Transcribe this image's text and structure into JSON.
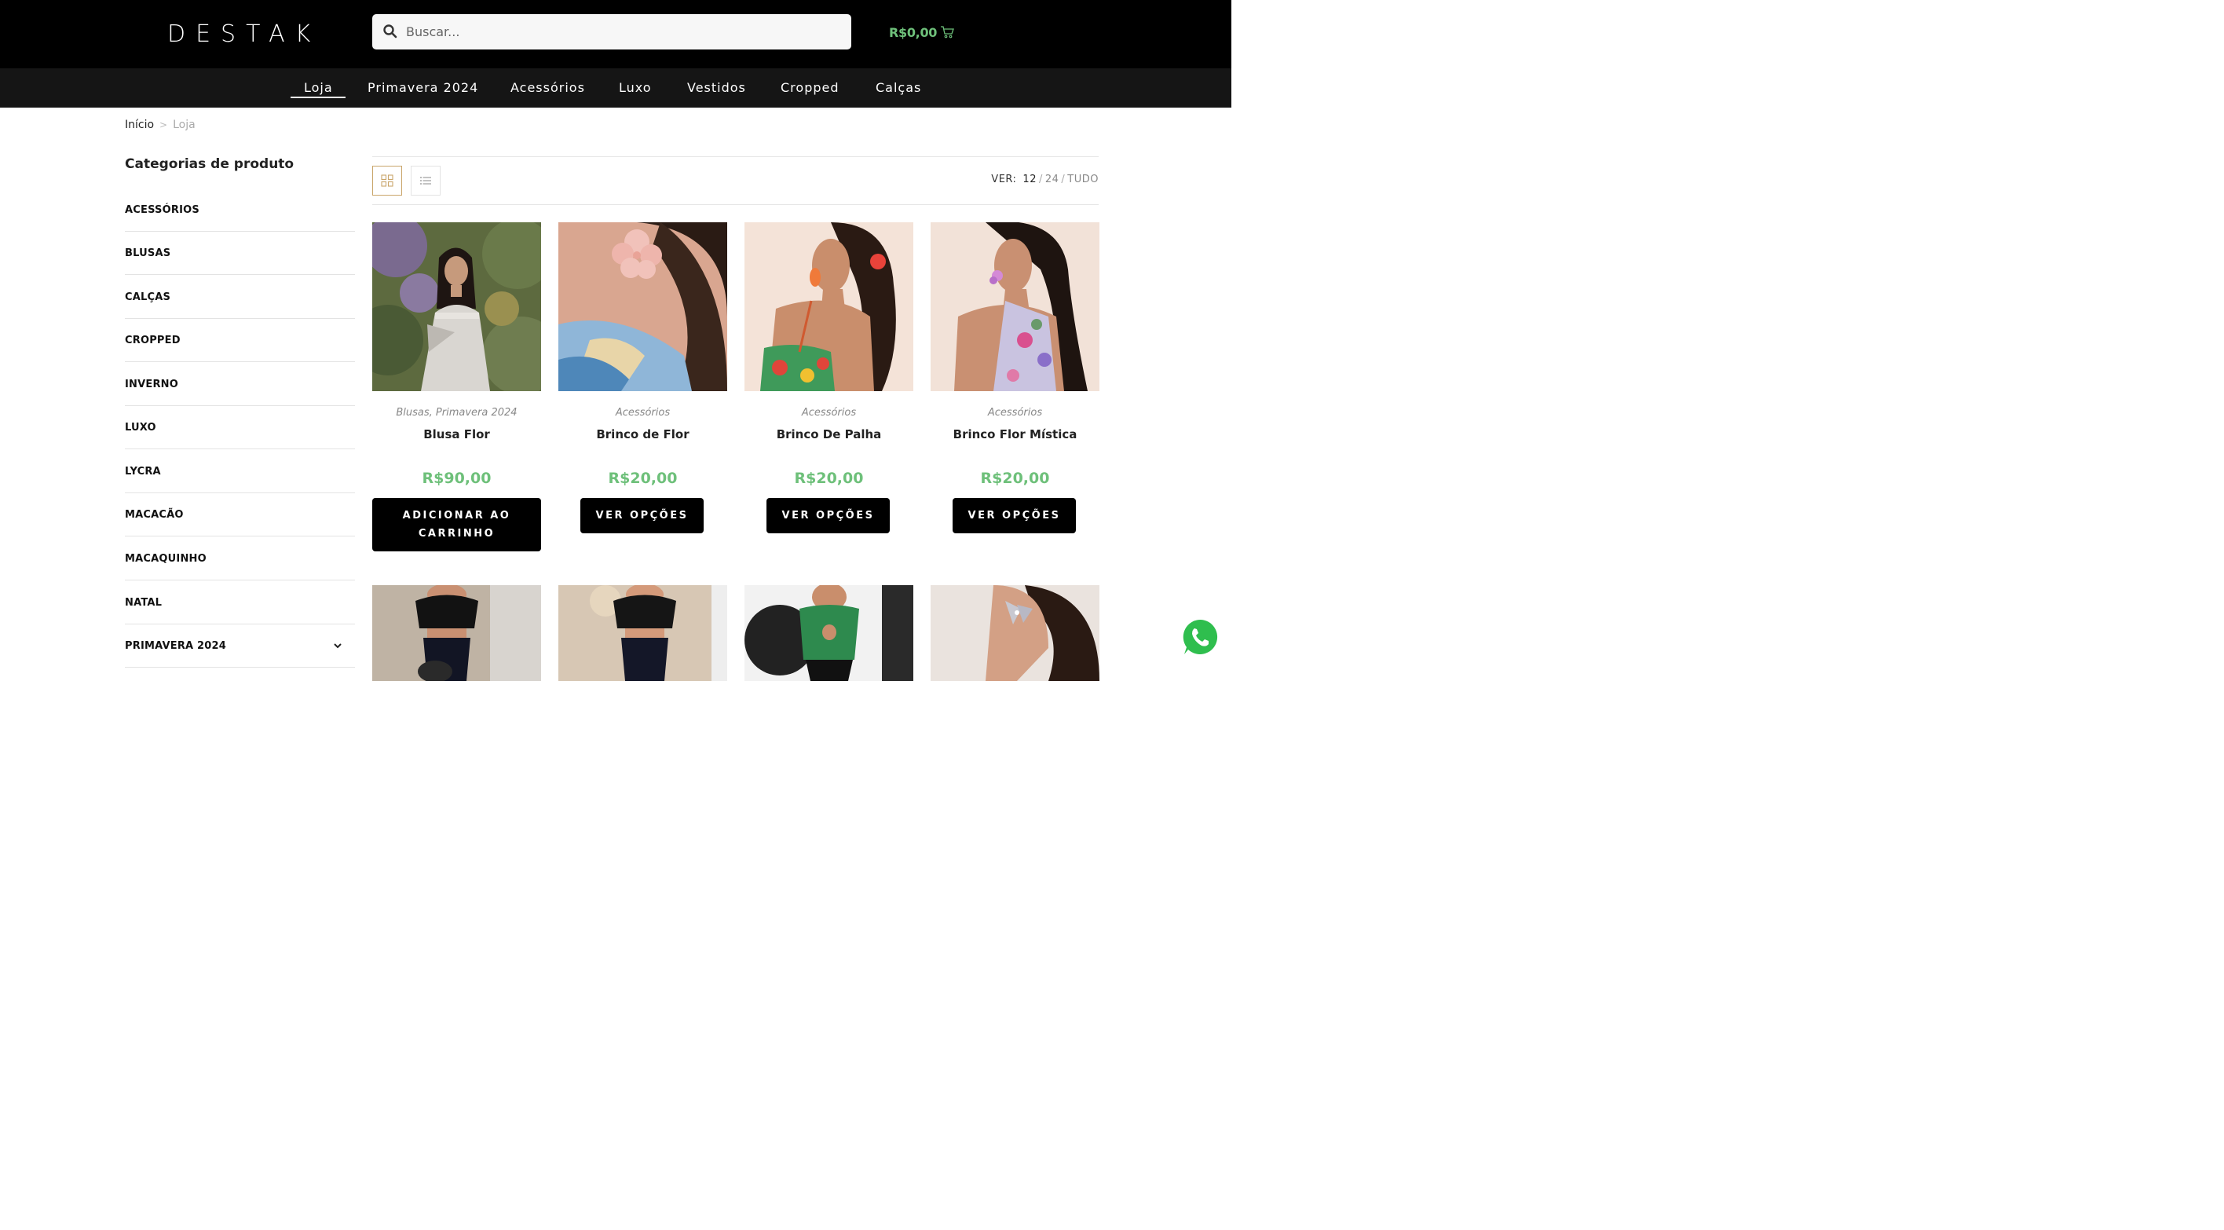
{
  "header": {
    "logo": "DESTAK",
    "search_placeholder": "Buscar...",
    "cart_total": "R$0,00"
  },
  "nav": {
    "items": [
      "Loja",
      "Primavera 2024",
      "Acessórios",
      "Luxo",
      "Vestidos",
      "Cropped",
      "Calças"
    ],
    "active": "Loja"
  },
  "breadcrumb": {
    "home": "Início",
    "separator": ">",
    "current": "Loja"
  },
  "sidebar": {
    "title": "Categorias de produto",
    "items": [
      "ACESSÓRIOS",
      "BLUSAS",
      "CALÇAS",
      "CROPPED",
      "INVERNO",
      "LUXO",
      "LYCRA",
      "MACACÃO",
      "MACAQUINHO",
      "NATAL",
      "PRIMAVERA 2024"
    ]
  },
  "toolbar": {
    "view_label": "VER:",
    "options": [
      "12",
      "24",
      "TUDO"
    ],
    "selected": "12"
  },
  "products": [
    {
      "categories": "Blusas, Primavera 2024",
      "name": "Blusa Flor",
      "price": "R$90,00",
      "button": "ADICIONAR AO CARRINHO",
      "image": "woman-white-dress-garden"
    },
    {
      "categories": "Acessórios",
      "name": "Brinco de Flor",
      "price": "R$20,00",
      "button": "VER OPÇÕES",
      "image": "pink-flower-earring"
    },
    {
      "categories": "Acessórios",
      "name": "Brinco De Palha",
      "price": "R$20,00",
      "button": "VER OPÇÕES",
      "image": "orange-straw-earring"
    },
    {
      "categories": "Acessórios",
      "name": "Brinco Flor Mística",
      "price": "R$20,00",
      "button": "VER OPÇÕES",
      "image": "pink-flower-mystic-earring"
    }
  ],
  "products_row2": [
    {
      "image": "black-crop-top-mirror"
    },
    {
      "image": "black-crop-top-chandelier"
    },
    {
      "image": "green-top-black-pants"
    },
    {
      "image": "butterfly-earring"
    }
  ],
  "colors": {
    "accent_green": "#6ec07a",
    "active_view_border": "#c9a56a",
    "header_bg": "#000000",
    "nav_bg": "#151515"
  },
  "widgets": {
    "chat_icon": "whatsapp-icon"
  }
}
